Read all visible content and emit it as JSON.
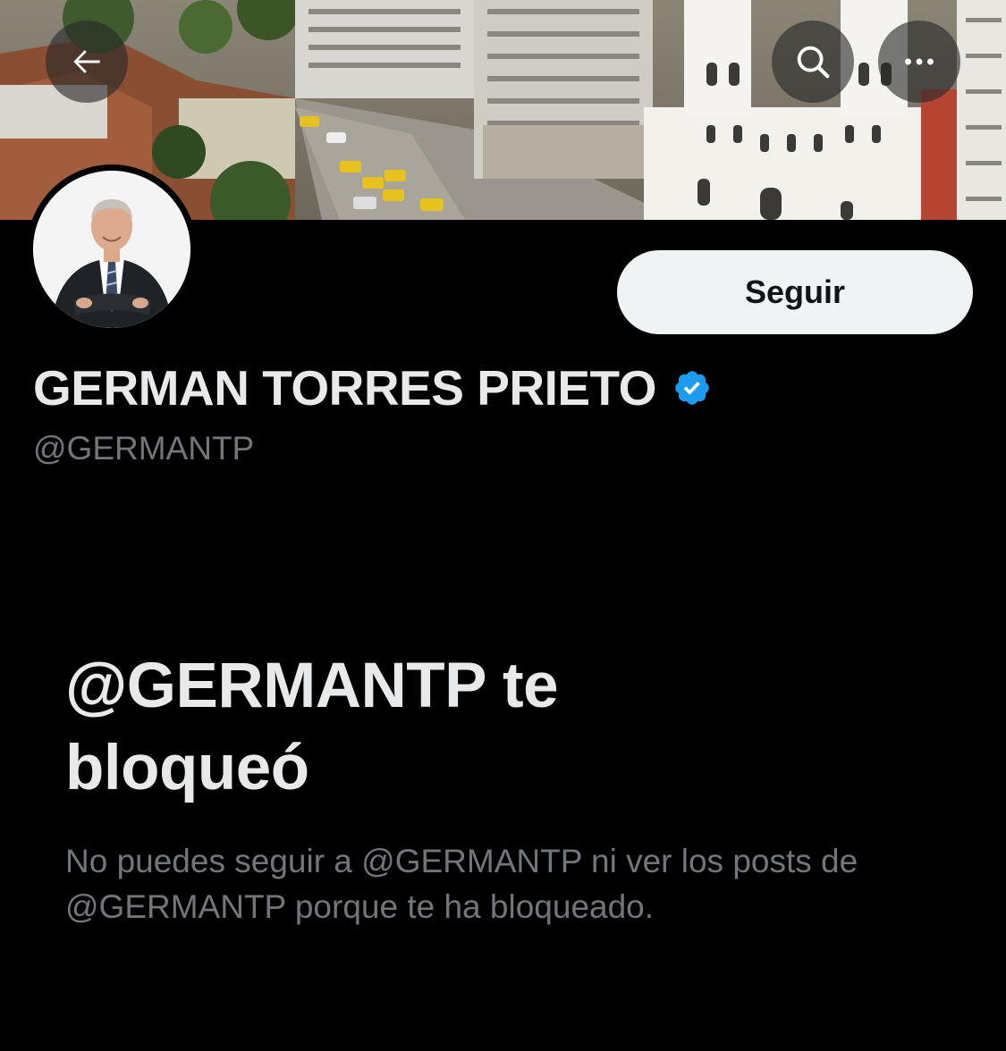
{
  "profile": {
    "display_name": "GERMAN TORRES PRIETO",
    "handle": "@GERMANTP",
    "verified": true,
    "verified_icon": "verified-badge-icon"
  },
  "header": {
    "back_icon": "back-arrow-icon",
    "search_icon": "search-icon",
    "more_icon": "more-options-icon"
  },
  "actions": {
    "follow_label": "Seguir"
  },
  "blocked": {
    "title": "@GERMANTP te bloqueó",
    "description": "No puedes seguir a @GERMANTP ni ver los posts de @GERMANTP porque te ha bloqueado."
  },
  "colors": {
    "background": "#000000",
    "primary_text": "#e7e9ea",
    "secondary_text": "#71767b",
    "follow_button_bg": "#eff3f4",
    "verified_blue": "#1d9bf0"
  }
}
